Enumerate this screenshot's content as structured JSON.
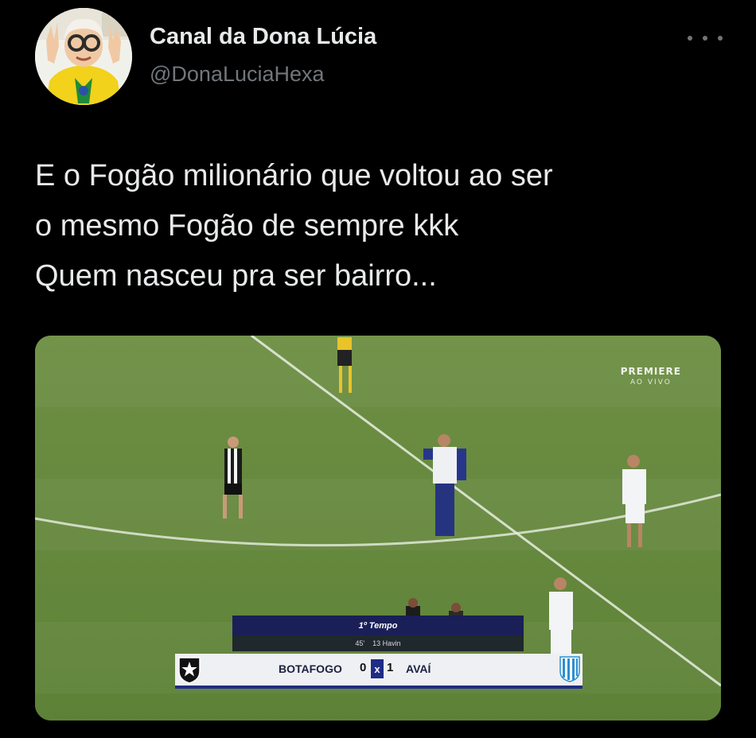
{
  "tweet": {
    "author_name": "Canal da Dona Lúcia",
    "author_handle": "@DonaLuciaHexa",
    "text_lines": [
      "E o Fogão milionário que voltou ao ser",
      "o mesmo Fogão de sempre kkk",
      "Quem nasceu pra ser bairro..."
    ],
    "more_icon": "more-horizontal-icon"
  },
  "media": {
    "broadcaster_name": "PREMIERE",
    "broadcaster_sub": "AO VIVO",
    "scoreboard": {
      "period": "1º Tempo",
      "clock": "45'",
      "extra_info": "13 Havin",
      "home_team": "BOTAFOGO",
      "home_score": "0",
      "separator": "x",
      "away_score": "1",
      "away_team": "AVAÍ",
      "home_crest_icon": "botafogo-star-crest-icon",
      "away_crest_icon": "avai-striped-crest-icon"
    }
  },
  "colors": {
    "background": "#000000",
    "name_text": "#e7e9ea",
    "handle_text": "#71767b",
    "pitch_green": "#66883d",
    "scoreboard_blue": "#1f2c86"
  }
}
